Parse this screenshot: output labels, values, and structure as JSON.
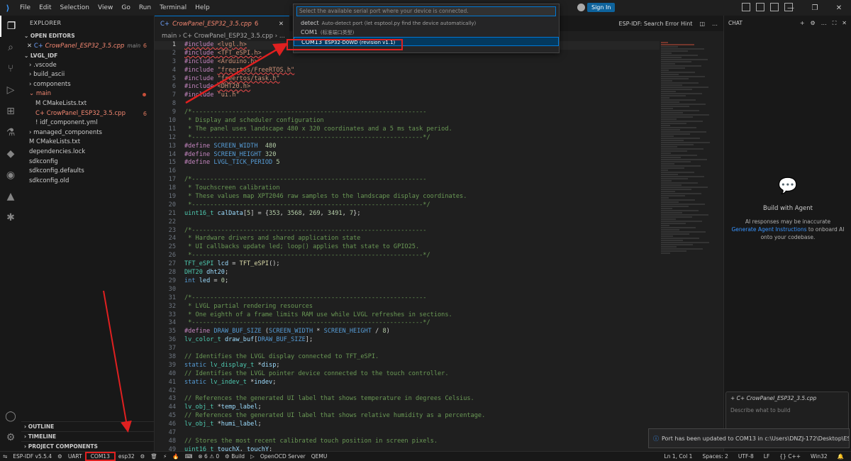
{
  "menu": [
    "File",
    "Edit",
    "Selection",
    "View",
    "Go",
    "Run",
    "Terminal",
    "Help"
  ],
  "titlebar": {
    "sign_in": "Sign In"
  },
  "explorer": {
    "title": "EXPLORER",
    "open_editors": "OPEN EDITORS",
    "open_file": "CrowPanel_ESP32_3.5.cpp",
    "open_file_sub": "main",
    "open_file_count": "6",
    "project": "LVGL_IDF",
    "items": [
      {
        "label": "› .vscode",
        "indent": 1
      },
      {
        "label": "› build_ascii",
        "indent": 1
      },
      {
        "label": "› components",
        "indent": 1
      },
      {
        "label": "⌄ main",
        "indent": 1,
        "err": true
      },
      {
        "label": "M CMakeLists.txt",
        "indent": 2
      },
      {
        "label": "C+ CrowPanel_ESP32_3.5.cpp",
        "indent": 2,
        "err": true,
        "count": "6"
      },
      {
        "label": "! idf_component.yml",
        "indent": 2
      },
      {
        "label": "› managed_components",
        "indent": 1
      },
      {
        "label": "M CMakeLists.txt",
        "indent": 1
      },
      {
        "label": "dependencies.lock",
        "indent": 1
      },
      {
        "label": "sdkconfig",
        "indent": 1
      },
      {
        "label": "sdkconfig.defaults",
        "indent": 1
      },
      {
        "label": "sdkconfig.old",
        "indent": 1
      }
    ],
    "outline": "OUTLINE",
    "timeline": "TIMELINE",
    "project_components": "PROJECT COMPONENTS"
  },
  "editor": {
    "tab_label": "CrowPanel_ESP32_3.5.cpp",
    "tab_count": "6",
    "breadcrumb": "main › C+ CrowPanel_ESP32_3.5.cpp › ...",
    "right_tool": "ESP-IDF: Search Error Hint"
  },
  "quick_pick": {
    "placeholder": "Select the available serial port where your device is connected.",
    "items": [
      {
        "label": "detect",
        "desc": "Auto-detect port (let esptool.py find the device automatically)"
      },
      {
        "label": "COM1",
        "desc": "(标准端口类型)"
      },
      {
        "label": "COM13",
        "desc": "ESP32-D0WD (revision v1.1)",
        "selected": true
      }
    ]
  },
  "chat": {
    "header": "CHAT",
    "title": "Build with Agent",
    "desc1": "AI responses may be inaccurate",
    "link": "Generate Agent Instructions",
    "desc2": " to onboard AI onto your codebase.",
    "input_file": "CrowPanel_ESP32_3.5.cpp",
    "input_placeholder": "Describe what to build"
  },
  "toast": "Port has been updated to COM13 in c:\\Users\\DNZJ-172\\Desktop\\ESP_...",
  "status": {
    "left": [
      "ESP-IDF v5.5.4",
      "⚙",
      "UART",
      "COM13",
      "esp32",
      "⚙",
      "🗑",
      "⚡",
      "🔥",
      "⌨",
      "⊗ 6 ⚠ 0",
      "⚙ Build",
      "▷",
      "OpenOCD Server",
      "QEMU"
    ],
    "right": [
      "Ln 1, Col 1",
      "Spaces: 2",
      "UTF-8",
      "LF",
      "{} C++",
      "Win32",
      "🔔"
    ]
  },
  "code": [
    {
      "n": "1",
      "t": [
        [
          "c-pp squig",
          "#include "
        ],
        [
          "c-inc squig",
          "<lvgl.h>"
        ]
      ]
    },
    {
      "n": "2",
      "t": [
        [
          "c-pp squig",
          "#include "
        ],
        [
          "c-inc squig",
          "<TFT_eSPI.h>"
        ]
      ]
    },
    {
      "n": "3",
      "t": [
        [
          "c-pp",
          "#include "
        ],
        [
          "c-inc",
          "<Arduino.h>"
        ]
      ]
    },
    {
      "n": "4",
      "t": [
        [
          "c-pp",
          "#include "
        ],
        [
          "c-inc squig",
          "\"freertos/FreeRTOS.h\""
        ]
      ]
    },
    {
      "n": "5",
      "t": [
        [
          "c-pp",
          "#include "
        ],
        [
          "c-inc squig",
          "\"freertos/task.h\""
        ]
      ]
    },
    {
      "n": "6",
      "t": [
        [
          "c-pp",
          "#include "
        ],
        [
          "c-inc squig",
          "<DHT20.h>"
        ]
      ]
    },
    {
      "n": "7",
      "t": [
        [
          "c-pp",
          "#include "
        ],
        [
          "c-inc",
          "\"ui.h\""
        ]
      ]
    },
    {
      "n": "8",
      "t": []
    },
    {
      "n": "9",
      "t": [
        [
          "c-cm",
          "/*----------------------------------------------------------------"
        ]
      ]
    },
    {
      "n": "10",
      "t": [
        [
          "c-cm",
          " * Display and scheduler configuration"
        ]
      ]
    },
    {
      "n": "11",
      "t": [
        [
          "c-cm",
          " * The panel uses landscape 480 x 320 coordinates and a 5 ms task period."
        ]
      ]
    },
    {
      "n": "12",
      "t": [
        [
          "c-cm",
          " *---------------------------------------------------------------*/"
        ]
      ]
    },
    {
      "n": "13",
      "t": [
        [
          "c-pp",
          "#define "
        ],
        [
          "c-mac",
          "SCREEN_WIDTH"
        ],
        [
          "c-txt",
          "  "
        ],
        [
          "c-num",
          "480"
        ]
      ]
    },
    {
      "n": "14",
      "t": [
        [
          "c-pp",
          "#define "
        ],
        [
          "c-mac",
          "SCREEN_HEIGHT"
        ],
        [
          "c-txt",
          " "
        ],
        [
          "c-num",
          "320"
        ]
      ]
    },
    {
      "n": "15",
      "t": [
        [
          "c-pp",
          "#define "
        ],
        [
          "c-mac",
          "LVGL_TICK_PERIOD"
        ],
        [
          "c-txt",
          " "
        ],
        [
          "c-num",
          "5"
        ]
      ]
    },
    {
      "n": "16",
      "t": []
    },
    {
      "n": "17",
      "t": [
        [
          "c-cm",
          "/*----------------------------------------------------------------"
        ]
      ]
    },
    {
      "n": "18",
      "t": [
        [
          "c-cm",
          " * Touchscreen calibration"
        ]
      ]
    },
    {
      "n": "19",
      "t": [
        [
          "c-cm",
          " * These values map XPT2046 raw samples to the landscape display coordinates."
        ]
      ]
    },
    {
      "n": "20",
      "t": [
        [
          "c-cm",
          " *---------------------------------------------------------------*/"
        ]
      ]
    },
    {
      "n": "21",
      "t": [
        [
          "c-ty",
          "uint16_t"
        ],
        [
          "c-txt",
          " "
        ],
        [
          "c-var",
          "calData"
        ],
        [
          "c-txt",
          "["
        ],
        [
          "c-num",
          "5"
        ],
        [
          "c-txt",
          "] = {"
        ],
        [
          "c-num",
          "353"
        ],
        [
          "c-txt",
          ", "
        ],
        [
          "c-num",
          "3568"
        ],
        [
          "c-txt",
          ", "
        ],
        [
          "c-num",
          "269"
        ],
        [
          "c-txt",
          ", "
        ],
        [
          "c-num",
          "3491"
        ],
        [
          "c-txt",
          ", "
        ],
        [
          "c-num",
          "7"
        ],
        [
          "c-txt",
          "};"
        ]
      ]
    },
    {
      "n": "22",
      "t": []
    },
    {
      "n": "23",
      "t": [
        [
          "c-cm",
          "/*----------------------------------------------------------------"
        ]
      ]
    },
    {
      "n": "24",
      "t": [
        [
          "c-cm",
          " * Hardware drivers and shared application state"
        ]
      ]
    },
    {
      "n": "25",
      "t": [
        [
          "c-cm",
          " * UI callbacks update led; loop() applies that state to GPIO25."
        ]
      ]
    },
    {
      "n": "26",
      "t": [
        [
          "c-cm",
          " *---------------------------------------------------------------*/"
        ]
      ]
    },
    {
      "n": "27",
      "t": [
        [
          "c-ty",
          "TFT_eSPI"
        ],
        [
          "c-txt",
          " "
        ],
        [
          "c-var",
          "lcd"
        ],
        [
          "c-txt",
          " = "
        ],
        [
          "c-fn",
          "TFT_eSPI"
        ],
        [
          "c-txt",
          "();"
        ]
      ]
    },
    {
      "n": "28",
      "t": [
        [
          "c-ty",
          "DHT20"
        ],
        [
          "c-txt",
          " "
        ],
        [
          "c-var",
          "dht20"
        ],
        [
          "c-txt",
          ";"
        ]
      ]
    },
    {
      "n": "29",
      "t": [
        [
          "c-kw",
          "int"
        ],
        [
          "c-txt",
          " "
        ],
        [
          "c-var",
          "led"
        ],
        [
          "c-txt",
          " = "
        ],
        [
          "c-num",
          "0"
        ],
        [
          "c-txt",
          ";"
        ]
      ]
    },
    {
      "n": "30",
      "t": []
    },
    {
      "n": "31",
      "t": [
        [
          "c-cm",
          "/*----------------------------------------------------------------"
        ]
      ]
    },
    {
      "n": "32",
      "t": [
        [
          "c-cm",
          " * LVGL partial rendering resources"
        ]
      ]
    },
    {
      "n": "33",
      "t": [
        [
          "c-cm",
          " * One eighth of a frame limits RAM use while LVGL refreshes in sections."
        ]
      ]
    },
    {
      "n": "34",
      "t": [
        [
          "c-cm",
          " *---------------------------------------------------------------*/"
        ]
      ]
    },
    {
      "n": "35",
      "t": [
        [
          "c-pp",
          "#define "
        ],
        [
          "c-mac",
          "DRAW_BUF_SIZE"
        ],
        [
          "c-txt",
          " ("
        ],
        [
          "c-mac",
          "SCREEN_WIDTH"
        ],
        [
          "c-txt",
          " * "
        ],
        [
          "c-mac",
          "SCREEN_HEIGHT"
        ],
        [
          "c-txt",
          " / "
        ],
        [
          "c-num",
          "8"
        ],
        [
          "c-txt",
          ")"
        ]
      ]
    },
    {
      "n": "36",
      "t": [
        [
          "c-ty",
          "lv_color_t"
        ],
        [
          "c-txt",
          " "
        ],
        [
          "c-var",
          "draw_buf"
        ],
        [
          "c-txt",
          "["
        ],
        [
          "c-mac",
          "DRAW_BUF_SIZE"
        ],
        [
          "c-txt",
          "];"
        ]
      ]
    },
    {
      "n": "37",
      "t": []
    },
    {
      "n": "38",
      "t": [
        [
          "c-cm",
          "// Identifies the LVGL display connected to TFT_eSPI."
        ]
      ]
    },
    {
      "n": "39",
      "t": [
        [
          "c-kw",
          "static"
        ],
        [
          "c-txt",
          " "
        ],
        [
          "c-ty",
          "lv_display_t"
        ],
        [
          "c-txt",
          " *"
        ],
        [
          "c-var",
          "disp"
        ],
        [
          "c-txt",
          ";"
        ]
      ]
    },
    {
      "n": "40",
      "t": [
        [
          "c-cm",
          "// Identifies the LVGL pointer device connected to the touch controller."
        ]
      ]
    },
    {
      "n": "41",
      "t": [
        [
          "c-kw",
          "static"
        ],
        [
          "c-txt",
          " "
        ],
        [
          "c-ty",
          "lv_indev_t"
        ],
        [
          "c-txt",
          " *"
        ],
        [
          "c-var",
          "indev"
        ],
        [
          "c-txt",
          ";"
        ]
      ]
    },
    {
      "n": "42",
      "t": []
    },
    {
      "n": "43",
      "t": [
        [
          "c-cm",
          "// References the generated UI label that shows temperature in degrees Celsius."
        ]
      ]
    },
    {
      "n": "44",
      "t": [
        [
          "c-ty",
          "lv_obj_t"
        ],
        [
          "c-txt",
          " *"
        ],
        [
          "c-var",
          "temp_label"
        ],
        [
          "c-txt",
          ";"
        ]
      ]
    },
    {
      "n": "45",
      "t": [
        [
          "c-cm",
          "// References the generated UI label that shows relative humidity as a percentage."
        ]
      ]
    },
    {
      "n": "46",
      "t": [
        [
          "c-ty",
          "lv_obj_t"
        ],
        [
          "c-txt",
          " *"
        ],
        [
          "c-var",
          "humi_label"
        ],
        [
          "c-txt",
          ";"
        ]
      ]
    },
    {
      "n": "47",
      "t": []
    },
    {
      "n": "48",
      "t": [
        [
          "c-cm",
          "// Stores the most recent calibrated touch position in screen pixels."
        ]
      ]
    },
    {
      "n": "49",
      "t": [
        [
          "c-ty",
          "uint16_t"
        ],
        [
          "c-txt",
          " "
        ],
        [
          "c-var",
          "touchX"
        ],
        [
          "c-txt",
          ", "
        ],
        [
          "c-var",
          "touchY"
        ],
        [
          "c-txt",
          ";"
        ]
      ]
    }
  ],
  "colors": {
    "accent": "#0078d4",
    "highlight": "#e02020",
    "error": "#f48771"
  }
}
